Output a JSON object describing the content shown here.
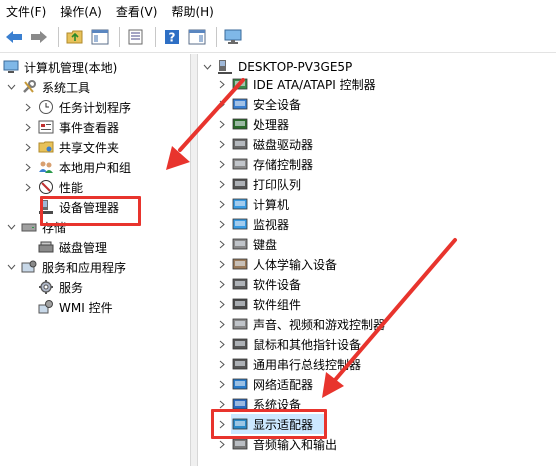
{
  "menu": [
    "文件(F)",
    "操作(A)",
    "查看(V)",
    "帮助(H)"
  ],
  "toolbar": {
    "icons": [
      "back-arrow-icon",
      "forward-arrow-icon",
      "up-folder-icon",
      "show-hide-tree-icon",
      "properties-icon",
      "help-icon",
      "action-pane-icon",
      "monitor-icon"
    ]
  },
  "left_tree": {
    "root": "计算机管理(本地)",
    "system_tools": "系统工具",
    "task_scheduler": "任务计划程序",
    "event_viewer": "事件查看器",
    "shared_folders": "共享文件夹",
    "local_users": "本地用户和组",
    "performance": "性能",
    "device_manager": "设备管理器",
    "storage": "存储",
    "disk_management": "磁盘管理",
    "services_apps": "服务和应用程序",
    "services": "服务",
    "wmi": "WMI 控件"
  },
  "right_tree": {
    "computer_name": "DESKTOP-PV3GE5P",
    "items": [
      "IDE ATA/ATAPI 控制器",
      "安全设备",
      "处理器",
      "磁盘驱动器",
      "存储控制器",
      "打印队列",
      "计算机",
      "监视器",
      "键盘",
      "人体学输入设备",
      "软件设备",
      "软件组件",
      "声音、视频和游戏控制器",
      "鼠标和其他指针设备",
      "通用串行总线控制器",
      "网络适配器",
      "系统设备",
      "显示适配器",
      "音频输入和输出"
    ]
  },
  "colors": {
    "annotation_red": "#e8342d",
    "selection": "#cce8ff"
  }
}
